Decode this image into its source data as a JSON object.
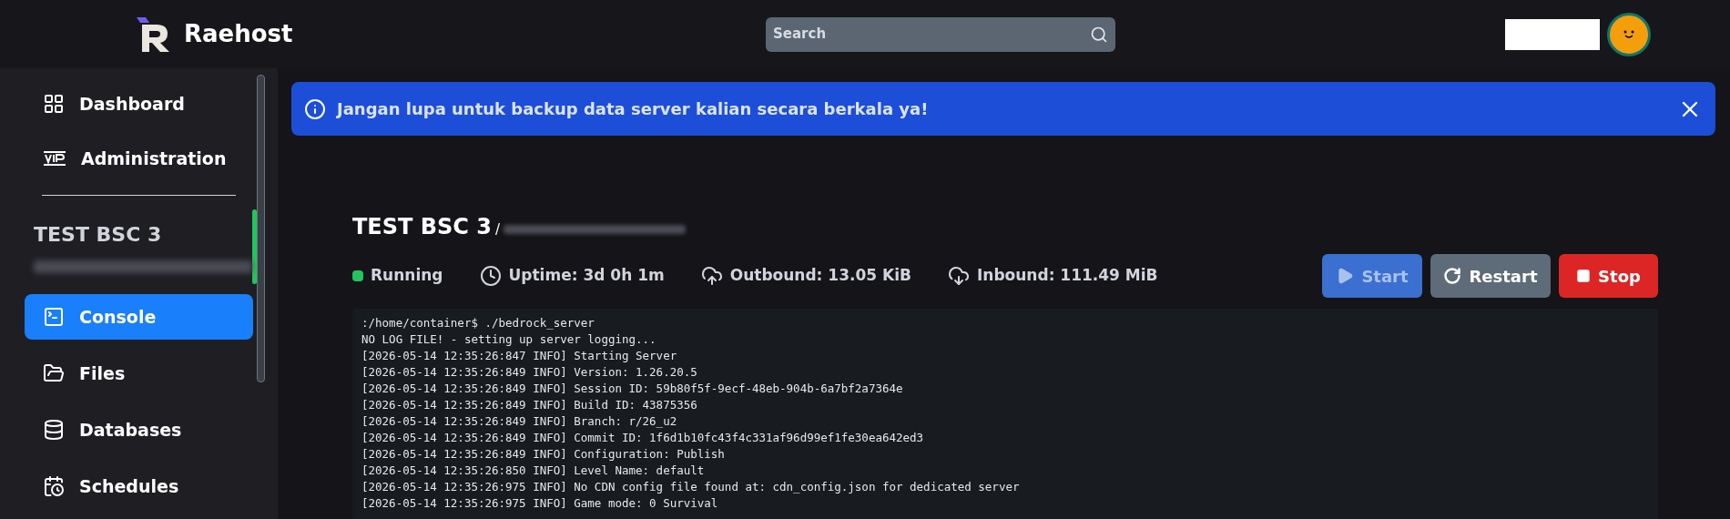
{
  "brand": {
    "name": "Raehost"
  },
  "search": {
    "placeholder": "Search"
  },
  "sidebar": {
    "items": [
      {
        "label": "Dashboard",
        "kind": "grid",
        "selected": false
      },
      {
        "label": "Administration",
        "kind": "vip",
        "selected": false
      }
    ],
    "server": {
      "name": "TEST BSC 3",
      "online": true
    },
    "server_items": [
      {
        "label": "Console",
        "kind": "terminal",
        "selected": true
      },
      {
        "label": "Files",
        "kind": "folder",
        "selected": false
      },
      {
        "label": "Databases",
        "kind": "database",
        "selected": false
      },
      {
        "label": "Schedules",
        "kind": "calendar",
        "selected": false
      }
    ]
  },
  "banner": {
    "text": "Jangan lupa untuk backup data server kalian secara berkala ya!"
  },
  "server": {
    "title": "TEST BSC 3",
    "separator": "/",
    "stats": [
      {
        "kind": "status",
        "text": "Running",
        "color": "#22c55e"
      },
      {
        "kind": "uptime",
        "text": "Uptime: 3d 0h 1m"
      },
      {
        "kind": "outbound",
        "text": "Outbound: 13.05 KiB"
      },
      {
        "kind": "inbound",
        "text": "Inbound: 111.49 MiB"
      }
    ],
    "buttons": [
      {
        "kind": "start",
        "label": "Start",
        "disabled": true
      },
      {
        "kind": "restart",
        "label": "Restart",
        "disabled": false
      },
      {
        "kind": "stop",
        "label": "Stop",
        "disabled": false
      }
    ]
  },
  "console": {
    "lines": [
      ":/home/container$ ./bedrock_server",
      "NO LOG FILE! - setting up server logging...",
      "[2026-05-14 12:35:26:847 INFO] Starting Server",
      "[2026-05-14 12:35:26:849 INFO] Version: 1.26.20.5",
      "[2026-05-14 12:35:26:849 INFO] Session ID: 59b80f5f-9ecf-48eb-904b-6a7bf2a7364e",
      "[2026-05-14 12:35:26:849 INFO] Build ID: 43875356",
      "[2026-05-14 12:35:26:849 INFO] Branch: r/26_u2",
      "[2026-05-14 12:35:26:849 INFO] Commit ID: 1f6d1b10fc43f4c331af96d99ef1fe30ea642ed3",
      "[2026-05-14 12:35:26:849 INFO] Configuration: Publish",
      "[2026-05-14 12:35:26:850 INFO] Level Name: default",
      "[2026-05-14 12:35:26:975 INFO] No CDN config file found at: cdn_config.json for dedicated server",
      "[2026-05-14 12:35:26:975 INFO] Game mode: 0 Survival"
    ]
  }
}
